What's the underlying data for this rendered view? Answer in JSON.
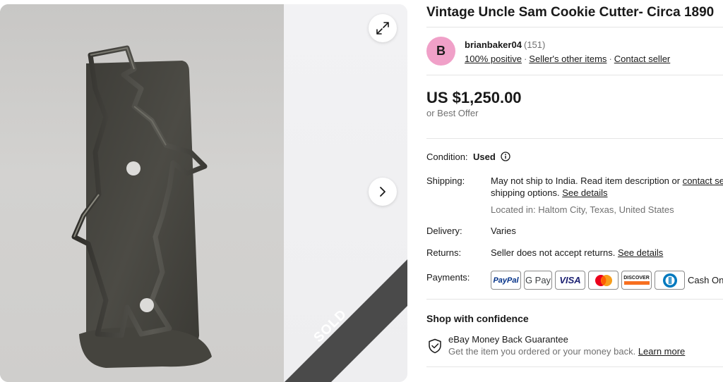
{
  "listing": {
    "title": "Vintage Uncle Sam Cookie Cutter- Circa 1890",
    "sold_label": "SOLD"
  },
  "gallery": {
    "expand_icon": "expand-icon",
    "next_icon": "chevron-right-icon"
  },
  "seller": {
    "avatar_letter": "B",
    "name": "brianbaker04",
    "feedback_count": "(151)",
    "positive": "100% positive",
    "other_items": "Seller's other items",
    "contact": "Contact seller",
    "separator": "·"
  },
  "price": {
    "amount": "US $1,250.00",
    "best_offer": "or Best Offer"
  },
  "details": {
    "condition_label": "Condition:",
    "condition_value": "Used",
    "shipping_label": "Shipping:",
    "shipping_text": "May not ship to India. Read item description or ",
    "shipping_contact": "contact sell",
    "shipping_text2": "shipping options. ",
    "shipping_see_details": "See details",
    "located": "Located in: Haltom City, Texas, United States",
    "delivery_label": "Delivery:",
    "delivery_value": "Varies",
    "returns_label": "Returns:",
    "returns_value": "Seller does not accept returns. ",
    "returns_see_details": "See details",
    "payments_label": "Payments:",
    "payment_methods": [
      "PayPal",
      "G Pay",
      "VISA",
      "Mastercard",
      "DISCOVER",
      "Diners Club"
    ],
    "cash_label": "Cash On P"
  },
  "confidence": {
    "title": "Shop with confidence",
    "mbg_title": "eBay Money Back Guarantee",
    "mbg_desc": "Get the item you ordered or your money back. ",
    "learn_more": "Learn more"
  },
  "colors": {
    "avatar_bg": "#f0a0c8",
    "paypal_blue": "#003087",
    "visa_blue": "#1a1f71",
    "mastercard_red": "#eb001b",
    "mastercard_yellow": "#f79e1b",
    "discover_orange": "#f76f20",
    "sold_ribbon": "#4a4a4a"
  }
}
